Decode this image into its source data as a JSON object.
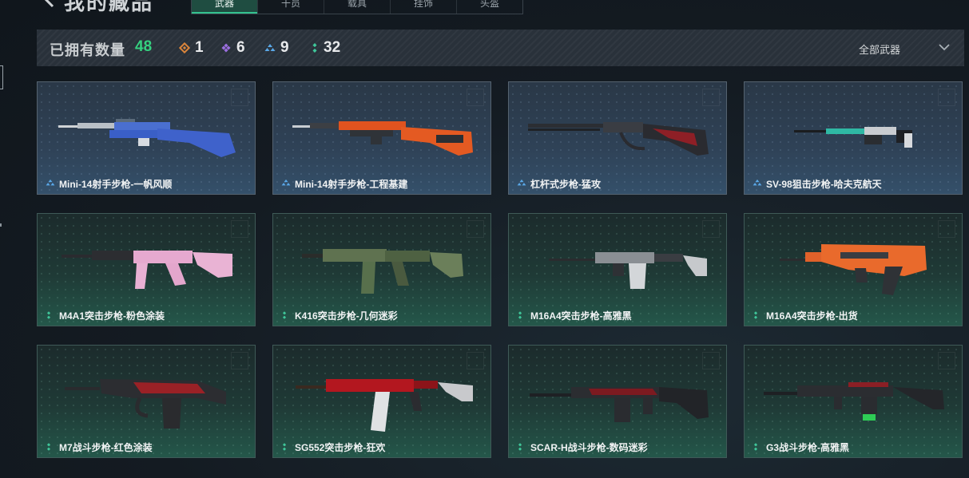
{
  "header": {
    "title": "我的藏品",
    "tabs": [
      {
        "label": "武器",
        "active": true
      },
      {
        "label": "干员",
        "active": false
      },
      {
        "label": "载具",
        "active": false
      },
      {
        "label": "挂饰",
        "active": false
      },
      {
        "label": "头盔",
        "active": false
      }
    ]
  },
  "stats": {
    "owned_label": "已拥有数量",
    "owned_count": "48",
    "rarities": [
      {
        "icon": "orange-diamond-icon",
        "color": "#d9843b",
        "count": "1"
      },
      {
        "icon": "purple-diamond-icon",
        "color": "#9b6fe0",
        "count": "6"
      },
      {
        "icon": "blue-triangle-icon",
        "color": "#5aa8e8",
        "count": "9"
      },
      {
        "icon": "green-dots-icon",
        "color": "#3fc79a",
        "count": "32"
      }
    ],
    "filter_label": "全部武器"
  },
  "colors": {
    "accent_green": "#35d07f",
    "blue_rarity": "#5aa8e8",
    "green_rarity": "#3fc79a"
  },
  "items": [
    {
      "name": "Mini-14射手步枪-一帆风顺",
      "rarity": "blue"
    },
    {
      "name": "Mini-14射手步枪-工程基建",
      "rarity": "blue"
    },
    {
      "name": "杠杆式步枪-猛攻",
      "rarity": "blue"
    },
    {
      "name": "SV-98狙击步枪-哈夫克航天",
      "rarity": "blue"
    },
    {
      "name": "M4A1突击步枪-粉色涂装",
      "rarity": "green"
    },
    {
      "name": "K416突击步枪-几何迷彩",
      "rarity": "green"
    },
    {
      "name": "M16A4突击步枪-高雅黑",
      "rarity": "green"
    },
    {
      "name": "M16A4突击步枪-出货",
      "rarity": "green"
    },
    {
      "name": "M7战斗步枪-红色涂装",
      "rarity": "green"
    },
    {
      "name": "SG552突击步枪-狂欢",
      "rarity": "green"
    },
    {
      "name": "SCAR-H战斗步枪-数码迷彩",
      "rarity": "green"
    },
    {
      "name": "G3战斗步枪-高雅黑",
      "rarity": "green"
    }
  ]
}
